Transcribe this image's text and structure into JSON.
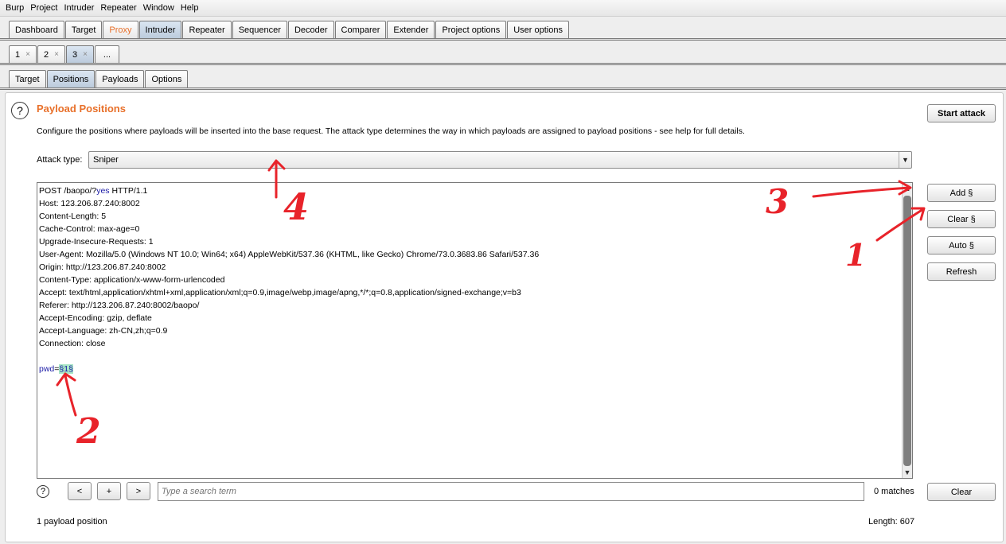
{
  "menu": [
    "Burp",
    "Project",
    "Intruder",
    "Repeater",
    "Window",
    "Help"
  ],
  "main_tabs": [
    {
      "label": "Dashboard",
      "name": "tab-dashboard"
    },
    {
      "label": "Target",
      "name": "tab-target"
    },
    {
      "label": "Proxy",
      "name": "tab-proxy"
    },
    {
      "label": "Intruder",
      "name": "tab-intruder",
      "selected": true
    },
    {
      "label": "Repeater",
      "name": "tab-repeater"
    },
    {
      "label": "Sequencer",
      "name": "tab-sequencer"
    },
    {
      "label": "Decoder",
      "name": "tab-decoder"
    },
    {
      "label": "Comparer",
      "name": "tab-comparer"
    },
    {
      "label": "Extender",
      "name": "tab-extender"
    },
    {
      "label": "Project options",
      "name": "tab-project-options"
    },
    {
      "label": "User options",
      "name": "tab-user-options"
    }
  ],
  "attack_tabs": [
    {
      "label": "1",
      "close": "×"
    },
    {
      "label": "2",
      "close": "×"
    },
    {
      "label": "3",
      "close": "×",
      "selected": true
    },
    {
      "label": "...",
      "close": ""
    }
  ],
  "sub_tabs": [
    {
      "label": "Target"
    },
    {
      "label": "Positions",
      "selected": true
    },
    {
      "label": "Payloads"
    },
    {
      "label": "Options"
    }
  ],
  "panel": {
    "help_glyph": "?",
    "title": "Payload Positions",
    "description": "Configure the positions where payloads will be inserted into the base request. The attack type determines the way in which payloads are assigned to payload positions - see help for full details.",
    "start_attack": "Start attack",
    "attack_type_label": "Attack type:",
    "attack_type_value": "Sniper",
    "side_buttons": {
      "add": "Add §",
      "clear": "Clear §",
      "auto": "Auto §",
      "refresh": "Refresh"
    }
  },
  "request": {
    "line1_prefix": "POST /baopo/?",
    "line1_kw": "yes",
    "line1_suffix": " HTTP/1.1",
    "headers": [
      "Host: 123.206.87.240:8002",
      "Content-Length: 5",
      "Cache-Control: max-age=0",
      "Upgrade-Insecure-Requests: 1",
      "User-Agent: Mozilla/5.0 (Windows NT 10.0; Win64; x64) AppleWebKit/537.36 (KHTML, like Gecko) Chrome/73.0.3683.86 Safari/537.36",
      "Origin: http://123.206.87.240:8002",
      "Content-Type: application/x-www-form-urlencoded",
      "Accept: text/html,application/xhtml+xml,application/xml;q=0.9,image/webp,image/apng,*/*;q=0.8,application/signed-exchange;v=b3",
      "Referer: http://123.206.87.240:8002/baopo/",
      "Accept-Encoding: gzip, deflate",
      "Accept-Language: zh-CN,zh;q=0.9",
      "Connection: close"
    ],
    "body_param": "pwd",
    "body_eq": "=",
    "body_marker": "§1§"
  },
  "search": {
    "prev": "<",
    "add": "+",
    "next": ">",
    "placeholder": "Type a search term",
    "matches": "0 matches",
    "clear": "Clear"
  },
  "footer": {
    "positions": "1 payload position",
    "length": "Length: 607"
  },
  "annotations": {
    "color": "#e8232a",
    "labels": [
      "1",
      "2",
      "3",
      "4"
    ]
  }
}
